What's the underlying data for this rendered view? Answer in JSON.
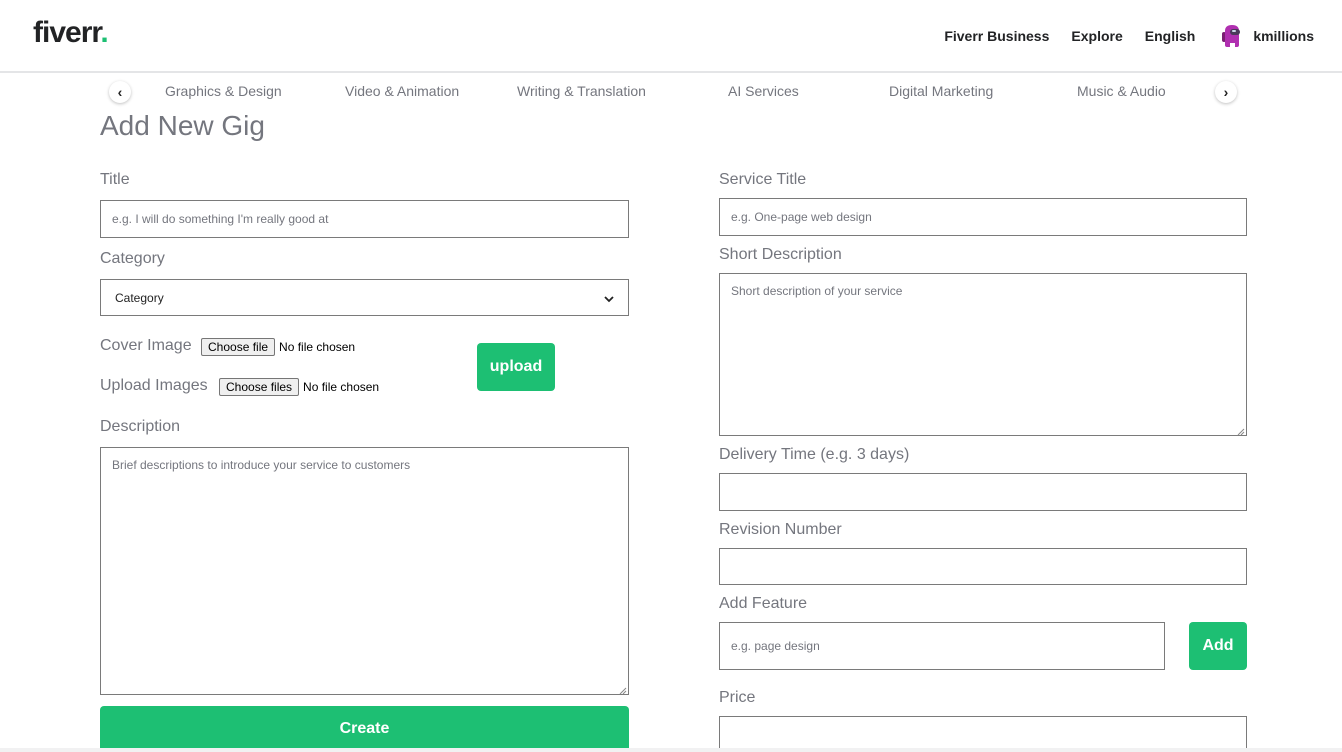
{
  "header": {
    "logo_text": "fiverr",
    "logo_dot": ".",
    "nav": {
      "business": "Fiverr Business",
      "explore": "Explore",
      "language": "English"
    },
    "user": {
      "name": "kmillions",
      "avatar_icon": "crewmate-avatar-icon"
    }
  },
  "categories": {
    "items": [
      "Graphics & Design",
      "Video & Animation",
      "Writing & Translation",
      "AI Services",
      "Digital Marketing",
      "Music & Audio"
    ],
    "prev_icon": "chevron-left-icon",
    "next_icon": "chevron-right-icon",
    "prev_glyph": "‹",
    "next_glyph": "›"
  },
  "page": {
    "title": "Add New Gig"
  },
  "left_form": {
    "title_label": "Title",
    "title_placeholder": "e.g. I will do something I'm really good at",
    "category_label": "Category",
    "category_selected": "Category",
    "cover_label": "Cover Image",
    "cover_button": "Choose file",
    "cover_status": "No file chosen",
    "images_label": "Upload Images",
    "images_button": "Choose files",
    "images_status": "No file chosen",
    "upload_button": "upload",
    "description_label": "Description",
    "description_placeholder": "Brief descriptions to introduce your service to customers",
    "create_button": "Create"
  },
  "right_form": {
    "service_title_label": "Service Title",
    "service_title_placeholder": "e.g. One-page web design",
    "short_desc_label": "Short Description",
    "short_desc_placeholder": "Short description of your service",
    "delivery_label": "Delivery Time (e.g. 3 days)",
    "delivery_value": "",
    "revision_label": "Revision Number",
    "revision_value": "",
    "feature_label": "Add Feature",
    "feature_placeholder": "e.g. page design",
    "add_button": "Add",
    "price_label": "Price",
    "price_value": ""
  },
  "colors": {
    "accent": "#1dbf73",
    "text": "#74767e",
    "dark": "#222325"
  }
}
